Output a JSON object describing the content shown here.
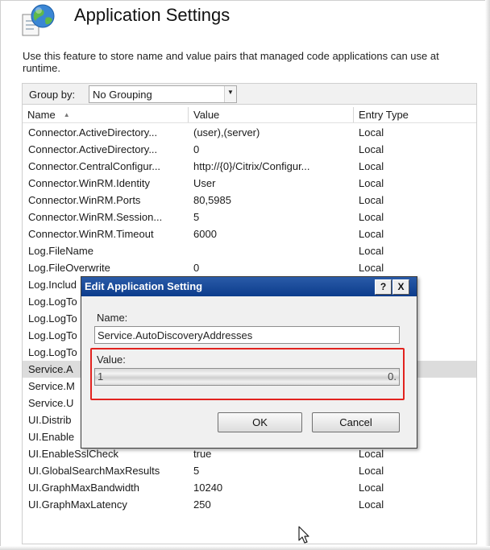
{
  "header": {
    "icon": "globe-document-icon",
    "title": "Application Settings",
    "description": "Use this feature to store name and value pairs that managed code applications can use at runtime."
  },
  "toolbar": {
    "group_by_label": "Group by:",
    "group_by_value": "No Grouping"
  },
  "grid": {
    "columns": [
      "Name",
      "Value",
      "Entry Type"
    ],
    "rows": [
      {
        "name": "Connector.ActiveDirectory...",
        "value": "(user),(server)",
        "type": "Local"
      },
      {
        "name": "Connector.ActiveDirectory...",
        "value": "0",
        "type": "Local"
      },
      {
        "name": "Connector.CentralConfigur...",
        "value": "http://{0}/Citrix/Configur...",
        "type": "Local"
      },
      {
        "name": "Connector.WinRM.Identity",
        "value": "User",
        "type": "Local"
      },
      {
        "name": "Connector.WinRM.Ports",
        "value": "80,5985",
        "type": "Local"
      },
      {
        "name": "Connector.WinRM.Session...",
        "value": "5",
        "type": "Local"
      },
      {
        "name": "Connector.WinRM.Timeout",
        "value": "6000",
        "type": "Local"
      },
      {
        "name": "Log.FileName",
        "value": "",
        "type": "Local"
      },
      {
        "name": "Log.FileOverwrite",
        "value": "0",
        "type": "Local"
      },
      {
        "name": "Log.Includ",
        "value": "",
        "type": "Local"
      },
      {
        "name": "Log.LogTo",
        "value": "",
        "type": "Local"
      },
      {
        "name": "Log.LogTo",
        "value": "",
        "type": "Local"
      },
      {
        "name": "Log.LogTo",
        "value": "",
        "type": "Local"
      },
      {
        "name": "Log.LogTo",
        "value": "",
        "type": "Local"
      },
      {
        "name": "Service.A",
        "value": "",
        "type": "Local"
      },
      {
        "name": "Service.M",
        "value": "",
        "type": "Local"
      },
      {
        "name": "Service.U",
        "value": "",
        "type": "Local"
      },
      {
        "name": "UI.Distrib",
        "value": "",
        "type": "Local"
      },
      {
        "name": "UI.Enable",
        "value": "",
        "type": "Local"
      },
      {
        "name": "UI.EnableSslCheck",
        "value": "true",
        "type": "Local"
      },
      {
        "name": "UI.GlobalSearchMaxResults",
        "value": "5",
        "type": "Local"
      },
      {
        "name": "UI.GraphMaxBandwidth",
        "value": "10240",
        "type": "Local"
      },
      {
        "name": "UI.GraphMaxLatency",
        "value": "250",
        "type": "Local"
      }
    ]
  },
  "dialog": {
    "title": "Edit Application Setting",
    "help_button": "?",
    "close_button": "X",
    "name_label": "Name:",
    "name_value": "Service.AutoDiscoveryAddresses",
    "value_label": "Value:",
    "value_prefix": "1",
    "value_suffix": "0.",
    "ok_label": "OK",
    "cancel_label": "Cancel"
  },
  "colors": {
    "titlebar": "#0c3c8c",
    "highlight_border": "#e2231f",
    "selected_row": "#dcdcdc"
  }
}
